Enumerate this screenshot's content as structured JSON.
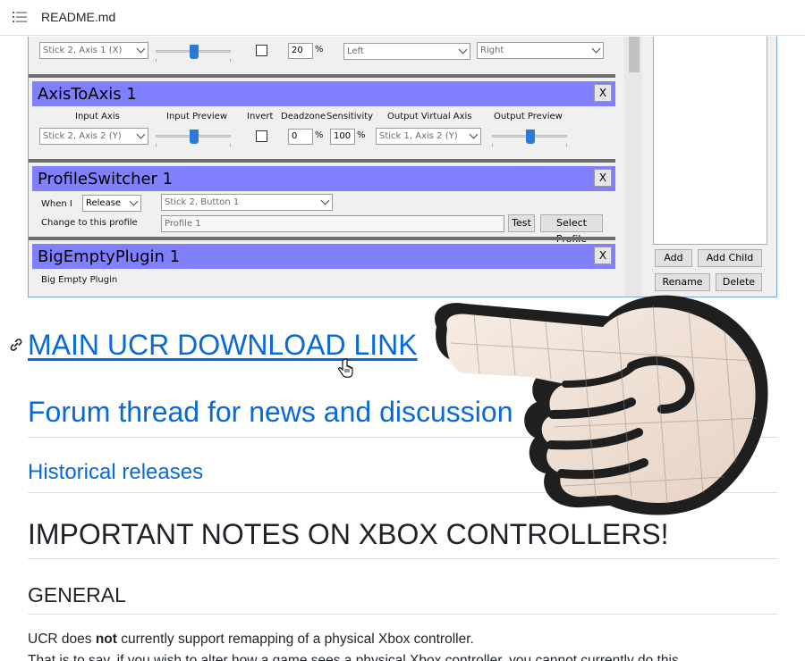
{
  "header": {
    "title": "README.md",
    "menu_icon": "list-icon"
  },
  "screenshot": {
    "top_row": {
      "input_axis": "Stick 2, Axis 1 (X)",
      "deadzone": "20",
      "pct": "%",
      "left_select": "Left",
      "right_select": "Right"
    },
    "axis_panel": {
      "title": "AxisToAxis 1",
      "close": "X",
      "labels": [
        "Input Axis",
        "Input Preview",
        "Invert",
        "Deadzone",
        "Sensitivity",
        "Output Virtual Axis",
        "Output Preview"
      ],
      "input_axis": "Stick 2, Axis 2 (Y)",
      "deadzone": "0",
      "sensitivity": "100",
      "pct": "%",
      "output_axis": "Stick 1, Axis 2 (Y)"
    },
    "profile_panel": {
      "title": "ProfileSwitcher 1",
      "close": "X",
      "when_label": "When I",
      "when_value": "Release",
      "button_value": "Stick 2, Button 1",
      "change_label": "Change to this profile",
      "profile_value": "Profile 1",
      "test_button": "Test",
      "select_button": "Select Profile"
    },
    "empty_panel": {
      "title": "BigEmptyPlugin 1",
      "close": "X",
      "body": "Big Empty Plugin"
    },
    "side_buttons": {
      "add": "Add",
      "add_child": "Add Child",
      "rename": "Rename",
      "delete": "Delete"
    }
  },
  "content": {
    "download_link": "MAIN UCR DOWNLOAD LINK",
    "forum_link": "Forum thread for news and discussion",
    "historical_link": "Historical releases",
    "important_heading": "IMPORTANT NOTES ON XBOX CONTROLLERS!",
    "general_heading": "GENERAL",
    "para_pre": "UCR does ",
    "para_bold": "not",
    "para_post": " currently support remapping of a physical Xbox controller.",
    "para2": "That is to say, if you wish to alter how a game sees a physical Xbox controller, you cannot currently do this"
  },
  "icons": {
    "anchor": "link-icon",
    "cursor": "hand-cursor-icon",
    "pointer_art": "pointing-hand-graphic"
  }
}
